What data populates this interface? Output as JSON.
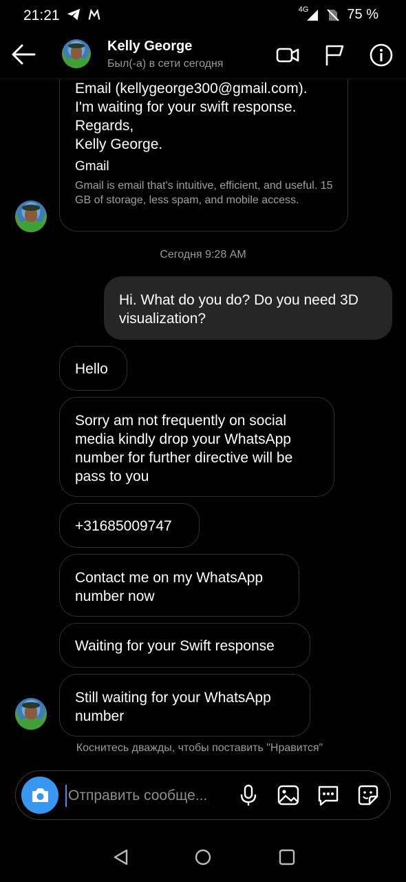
{
  "status_bar": {
    "time": "21:21",
    "network": "4G",
    "battery": "75 %"
  },
  "header": {
    "name": "Kelly George",
    "status": "Был(-а) в сети сегодня"
  },
  "messages": {
    "link_card": {
      "text": "Email (kellygeorge300@gmail.com).\nI'm waiting for your swift response.\nRegards,\nKelly George.",
      "title": "Gmail",
      "description": "Gmail is email that's intuitive, efficient, and useful. 15 GB of storage, less spam, and mobile access."
    },
    "timestamp": "Сегодня 9:28 AM",
    "outgoing": "Hi. What do you do?  Do you need 3D visualization?",
    "incoming": [
      "Hello",
      "Sorry am not frequently on social media kindly drop your WhatsApp number for further directive will be pass to you",
      "+31685009747",
      "Contact me on my WhatsApp number now",
      "Waiting for your Swift response",
      "Still waiting for your WhatsApp number"
    ],
    "double_tap_hint": "Коснитесь дважды, чтобы поставить \"Нравится\""
  },
  "composer": {
    "placeholder": "Отправить сообще..."
  },
  "colors": {
    "accent": "#3897f0",
    "outgoing_bubble": "#262626",
    "bubble_border": "#2e2e2e"
  }
}
